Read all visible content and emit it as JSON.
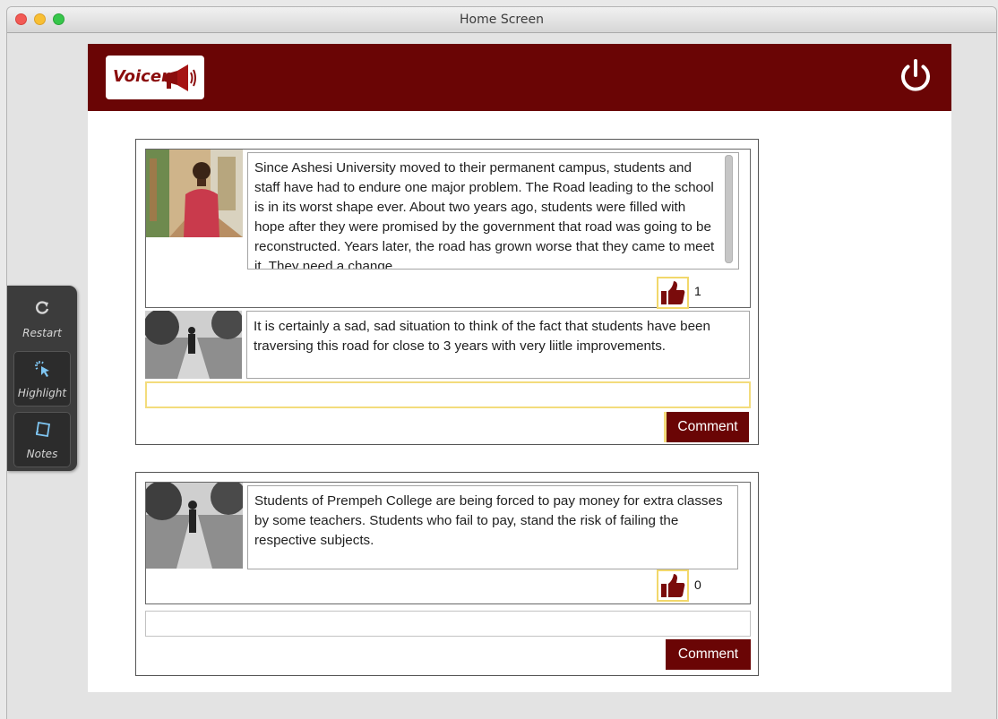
{
  "window": {
    "title": "Home Screen"
  },
  "app": {
    "logo_text": "Voicer"
  },
  "sidebar": {
    "tools": [
      {
        "label": "Restart",
        "icon": "restart-icon"
      },
      {
        "label": "Highlight",
        "icon": "highlight-icon"
      },
      {
        "label": "Notes",
        "icon": "notes-icon"
      }
    ]
  },
  "posts": [
    {
      "text": "Since Ashesi University moved to their permanent campus, students and staff have had to endure one major problem. The Road leading to the school is in its worst shape ever. About two years ago, students were filled with hope after they were promised by the government that road was going to be reconstructed. Years later, the road has grown worse that they came to meet it. They need a change.",
      "likes": "1",
      "comments": [
        {
          "text": "It is certainly a sad, sad situation to think of the fact that students have been traversing this road for close to 3 years with very liitle improvements."
        }
      ],
      "comment_input_value": "",
      "comment_button": "Comment"
    },
    {
      "text": "Students of Prempeh College are being forced to pay money for extra classes by some teachers. Students who fail to pay, stand the risk of failing the respective subjects.",
      "likes": "0",
      "comments": [],
      "comment_input_value": "",
      "comment_button": "Comment"
    }
  ],
  "colors": {
    "brand": "#6a0505",
    "highlight": "#f3dc7c",
    "thumb": "#7a0b0b"
  }
}
